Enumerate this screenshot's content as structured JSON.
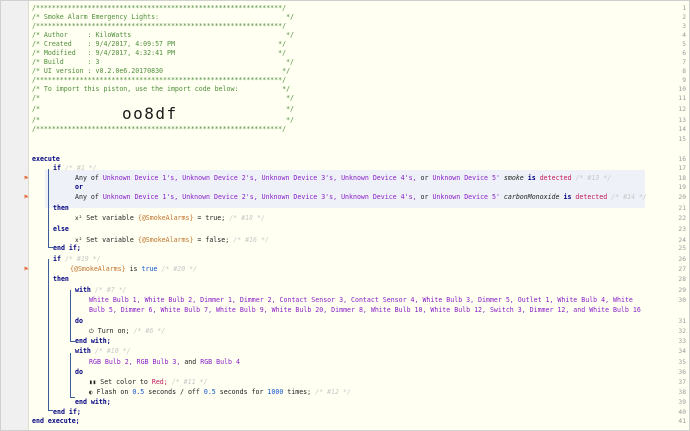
{
  "header": {
    "border": "/**************************************************************/",
    "title": "/* Smoke Alarm Emergency Lights:                                */",
    "sep": "/**************************************************************/",
    "author": "/* Author     : KiloWatts                                       */",
    "created": "/* Created    : 9/4/2017, 4:09:57 PM                          */",
    "modified": "/* Modified   : 9/4/2017, 4:32:41 PM                          */",
    "build": "/* Build      : 3                                               */",
    "ui_version": "/* UI version : v0.2.0e6.20170830                              */",
    "sep2": "/**************************************************************/",
    "import_line": "/* To import this piston, use the import code below:           */",
    "blank1": "/*                                                              */",
    "blank2": "/*                                                              */",
    "blank3": "/*                                                              */",
    "border2": "/**************************************************************/",
    "import_code": "oo8df"
  },
  "lines": [
    "1",
    "2",
    "3",
    "4",
    "5",
    "6",
    "7",
    "8",
    "9",
    "10",
    "11",
    "12",
    "13",
    "14",
    "15",
    "16",
    "17",
    "18",
    "19",
    "20",
    "21",
    "22",
    "23",
    "24",
    "25",
    "26",
    "27",
    "28",
    "29",
    "30",
    "31",
    "32",
    "33",
    "34",
    "35",
    "36",
    "37",
    "38",
    "39",
    "40",
    "41"
  ],
  "code": {
    "execute": "execute",
    "if1": "if",
    "if1_c": "/* #1 */",
    "anyof": "Any of",
    "dev1": "Unknown Device 1's,",
    "dev2": "Unknown Device 2's,",
    "dev3": "Unknown Device 3's,",
    "dev4": "Unknown Device 4's,",
    "or_w": "or",
    "dev5": "Unknown Device 5'",
    "smoke_attr": "smoke",
    "is_w": "is",
    "detected": "detected",
    "c13": "/* #13 */",
    "or": "or",
    "co_attr": "carbonMonoxide",
    "c14": "/* #14 */",
    "then": "then",
    "setvar": "Set variable",
    "var_smoke": "{@SmokeAlarms}",
    "eq_true": "= true;",
    "c18": "/* #18 */",
    "else": "else",
    "eq_false": "= false;",
    "c16": "/* #16 */",
    "endif": "end if;",
    "if2": "if",
    "if2_c": "/* #19 */",
    "smoke_var": "{@SmokeAlarms}",
    "is": "is",
    "true": "true",
    "c20": "/* #20 */",
    "then2": "then",
    "with": "with",
    "c7": "/* #7 */",
    "devs_a": "White Bulb 1, White Bulb 2, Dimmer 1, Dimmer 2, Contact Sensor 3, Contact Sensor 4, White Bulb 3, Dimmer 5, Outlet 1, White Bulb 4, White",
    "devs_b": "Bulb 5, Dimmer 6, White Bulb 7, White Bulb 9, White Bulb 20, Dimmer 8, White Bulb 10, White Bulb 12, Switch 3, Dimmer 12, and White Bulb 16",
    "do": "do",
    "turn_on": "Turn on;",
    "c6": "/* #6 */",
    "endwith": "end with;",
    "with2": "with",
    "c10": "/* #10 */",
    "rgb_a": "RGB Bulb 2,",
    "rgb_b": "RGB Bulb 3,",
    "and": "and",
    "rgb_c": "RGB Bulb 4",
    "do2": "do",
    "setcolor": "Set color to",
    "red": "Red;",
    "c11": "/* #11 */",
    "flash_on": "Flash on",
    "half": "0.5",
    "sec_off": "seconds / off",
    "sec_for": "seconds for",
    "times": "1000",
    "times_w": "times;",
    "c12": "/* #12 */",
    "endwith2": "end with;",
    "endif2": "end if;",
    "endexec": "end execute;"
  },
  "colors": {
    "background": "#fffff2",
    "comment": "#4f8f3a",
    "keyword": "#000080",
    "device": "#8a22c8",
    "operator": "#c2185b",
    "marker": "#e8612b"
  }
}
